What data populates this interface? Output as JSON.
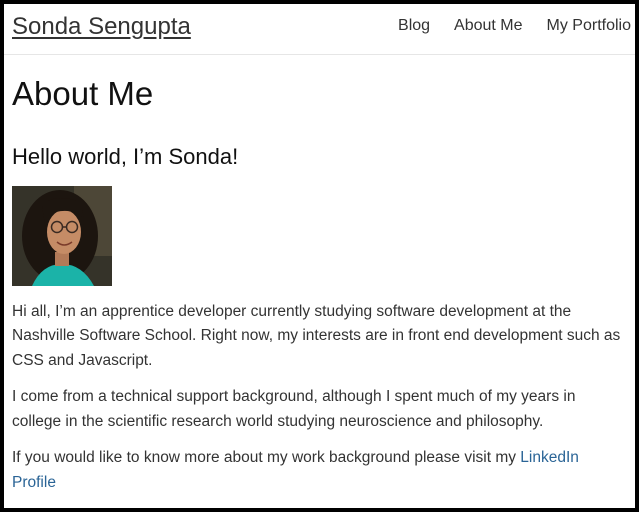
{
  "header": {
    "site_title": "Sonda Sengupta",
    "nav": [
      {
        "label": "Blog"
      },
      {
        "label": "About Me"
      },
      {
        "label": "My Portfolio"
      }
    ]
  },
  "main": {
    "page_title": "About Me",
    "greeting": "Hello world, I’m Sonda!",
    "paragraphs": [
      "Hi all, I’m an apprentice developer currently studying software development at the Nashville Software School. Right now, my interests are in front end development such as CSS and Javascript.",
      "I come from a technical support background, although I spent much of my years in college in the scientific research world studying neuroscience and philosophy."
    ],
    "linkedin_paragraph": {
      "text": "If you would like to know more about my work background please visit my ",
      "link_text": "LinkedIn Profile"
    }
  },
  "colors": {
    "link": "#2a6496",
    "text": "#333333",
    "frame": "#000000"
  }
}
